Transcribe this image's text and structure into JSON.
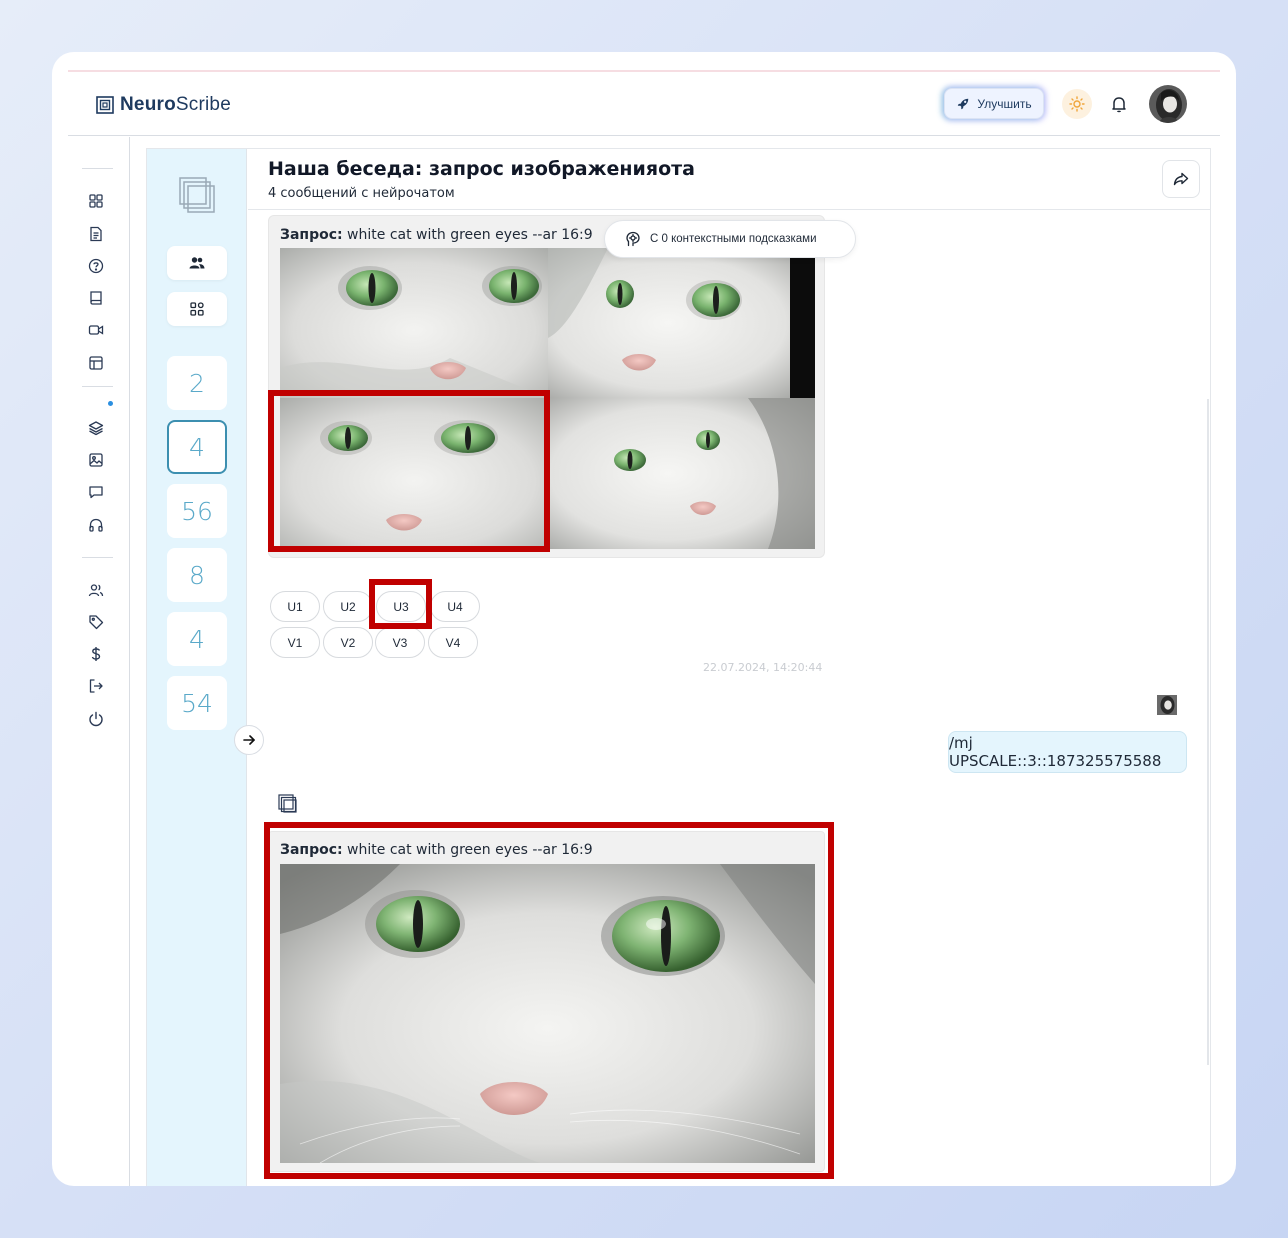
{
  "header": {
    "logo_bold": "Neuro",
    "logo_light": "Scribe",
    "upgrade_label": "Улучшить"
  },
  "sidebar": {
    "icons": [
      "dashboard-icon",
      "document-icon",
      "help-icon",
      "book-icon",
      "video-icon",
      "table-icon",
      "layers-icon",
      "image-icon",
      "chat-icon",
      "headphones-icon",
      "users-icon",
      "tag-icon",
      "dollar-icon",
      "logout-icon",
      "power-icon"
    ]
  },
  "channels": {
    "numbers": [
      "2",
      "4",
      "56",
      "8",
      "4",
      "54"
    ],
    "active_index": 1
  },
  "chat": {
    "title": "Наша беседа: запрос изображенияота",
    "subtitle": "4 сообщений с нейрочатом",
    "context_pill": "С 0 контекстными подсказками",
    "message1": {
      "request_label": "Запрос:",
      "request_text": " white cat with green eyes --ar 16:9",
      "upscale_buttons": [
        "U1",
        "U2",
        "U3",
        "U4"
      ],
      "variation_buttons": [
        "V1",
        "V2",
        "V3",
        "V4"
      ],
      "timestamp": "22.07.2024, 14:20:44"
    },
    "user_message": "/mj UPSCALE::3::187325575588",
    "message2": {
      "request_label": "Запрос:",
      "request_text": " white cat with green eyes --ar 16:9"
    }
  },
  "colors": {
    "accent_highlight": "#c00000",
    "channel_bg": "#e4f5fd",
    "number_color": "#5aa9c9",
    "brand_navy": "#1e3a5f"
  }
}
